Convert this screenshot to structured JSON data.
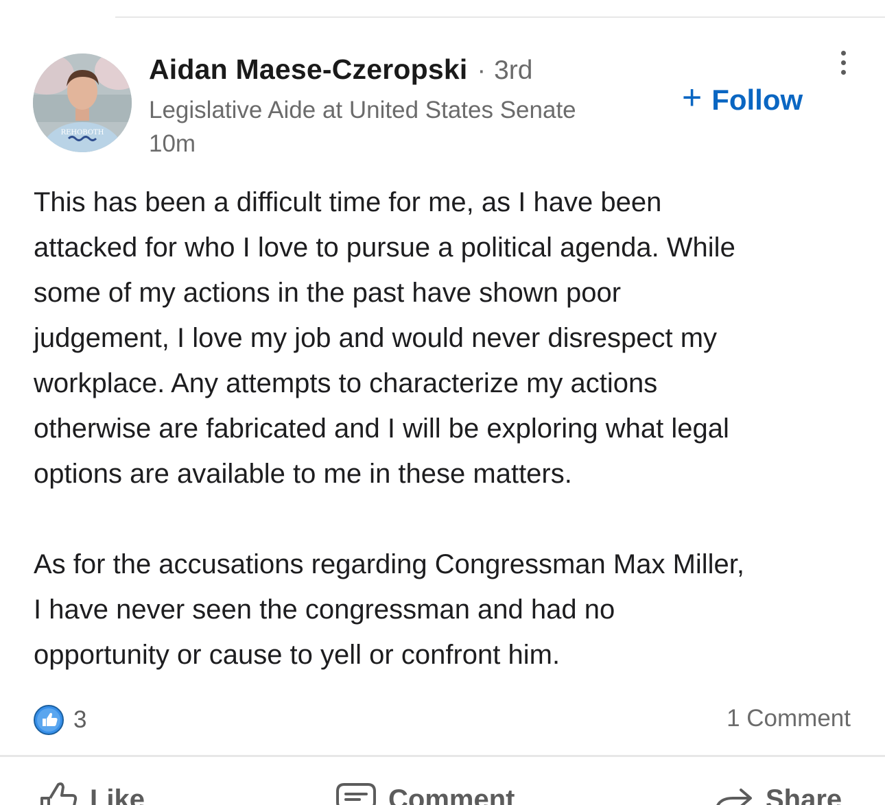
{
  "post": {
    "author": {
      "name": "Aidan Maese-Czeropski",
      "separator": "·",
      "degree": "3rd",
      "headline": "Legislative Aide at United States Senate",
      "timestamp": "10m"
    },
    "follow": {
      "icon": "plus-icon",
      "label": "Follow",
      "color": "#0a66c2"
    },
    "more_icon": "vertical-ellipsis-icon",
    "body": {
      "lines_p1": [
        "This has been a difficult time for me, as I have been",
        "attacked for who I love to pursue a political agenda. While",
        "some of my actions in the past have shown poor",
        "judgement, I love my job and would never disrespect my",
        "workplace. Any attempts to characterize my actions",
        "otherwise are fabricated and I will be exploring what legal",
        "options are available to me in these matters."
      ],
      "lines_p2": [
        "As for the accusations regarding Congressman Max Miller,",
        "I have never seen the congressman and had no",
        "opportunity or cause to yell or confront him."
      ]
    },
    "social": {
      "reaction_icon": "like-reaction-icon",
      "reaction_count": "3",
      "comment_count": "1 Comment"
    },
    "actions": [
      {
        "icon": "thumbs-up-icon",
        "label": "Like"
      },
      {
        "icon": "comment-icon",
        "label": "Comment"
      },
      {
        "icon": "share-arrow-icon",
        "label": "Share"
      }
    ]
  }
}
